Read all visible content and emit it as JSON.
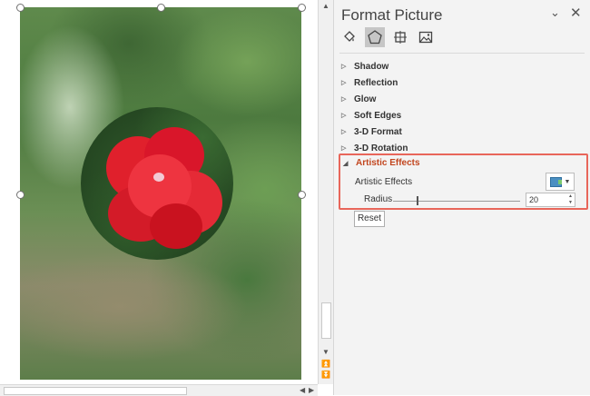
{
  "pane": {
    "title": "Format Picture",
    "tabs": [
      {
        "icon": "fill-line-icon",
        "label": "Fill & Line"
      },
      {
        "icon": "effects-icon",
        "label": "Effects"
      },
      {
        "icon": "size-properties-icon",
        "label": "Size & Properties"
      },
      {
        "icon": "picture-icon",
        "label": "Picture"
      }
    ],
    "sections": [
      {
        "label": "Shadow"
      },
      {
        "label": "Reflection"
      },
      {
        "label": "Glow"
      },
      {
        "label": "Soft Edges"
      },
      {
        "label": "3-D Format"
      },
      {
        "label": "3-D Rotation"
      }
    ],
    "artistic_effects": {
      "header": "Artistic Effects",
      "label": "Artistic Effects",
      "radius_label": "Radius",
      "radius_value": "20",
      "reset_label": "Reset"
    }
  },
  "colors": {
    "accent_header": "#c2461f",
    "highlight_box": "#e8665a",
    "active_tab": "#c6c6c6",
    "pane_background": "#f3f3f3"
  }
}
